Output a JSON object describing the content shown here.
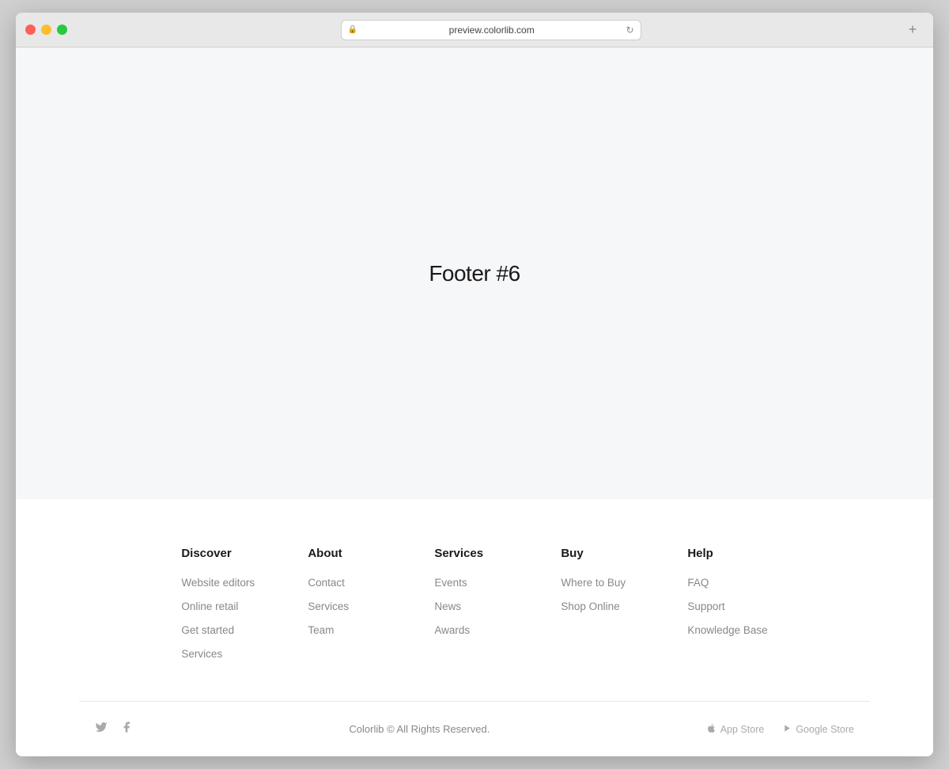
{
  "browser": {
    "url": "preview.colorlib.com",
    "tab_add_label": "+",
    "reload_icon": "↻"
  },
  "main": {
    "title": "Footer #6"
  },
  "footer": {
    "columns": [
      {
        "heading": "Discover",
        "links": [
          "Website editors",
          "Online retail",
          "Get started",
          "Services"
        ]
      },
      {
        "heading": "About",
        "links": [
          "Contact",
          "Services",
          "Team"
        ]
      },
      {
        "heading": "Services",
        "links": [
          "Events",
          "News",
          "Awards"
        ]
      },
      {
        "heading": "Buy",
        "links": [
          "Where to Buy",
          "Shop Online"
        ]
      },
      {
        "heading": "Help",
        "links": [
          "FAQ",
          "Support",
          "Knowledge Base"
        ]
      }
    ],
    "copyright": "Colorlib © All Rights Reserved.",
    "social": {
      "twitter": "𝕏",
      "facebook": "f"
    },
    "stores": [
      {
        "icon": "⊞",
        "label": "App Store"
      },
      {
        "icon": "▶",
        "label": "Google Store"
      }
    ]
  }
}
